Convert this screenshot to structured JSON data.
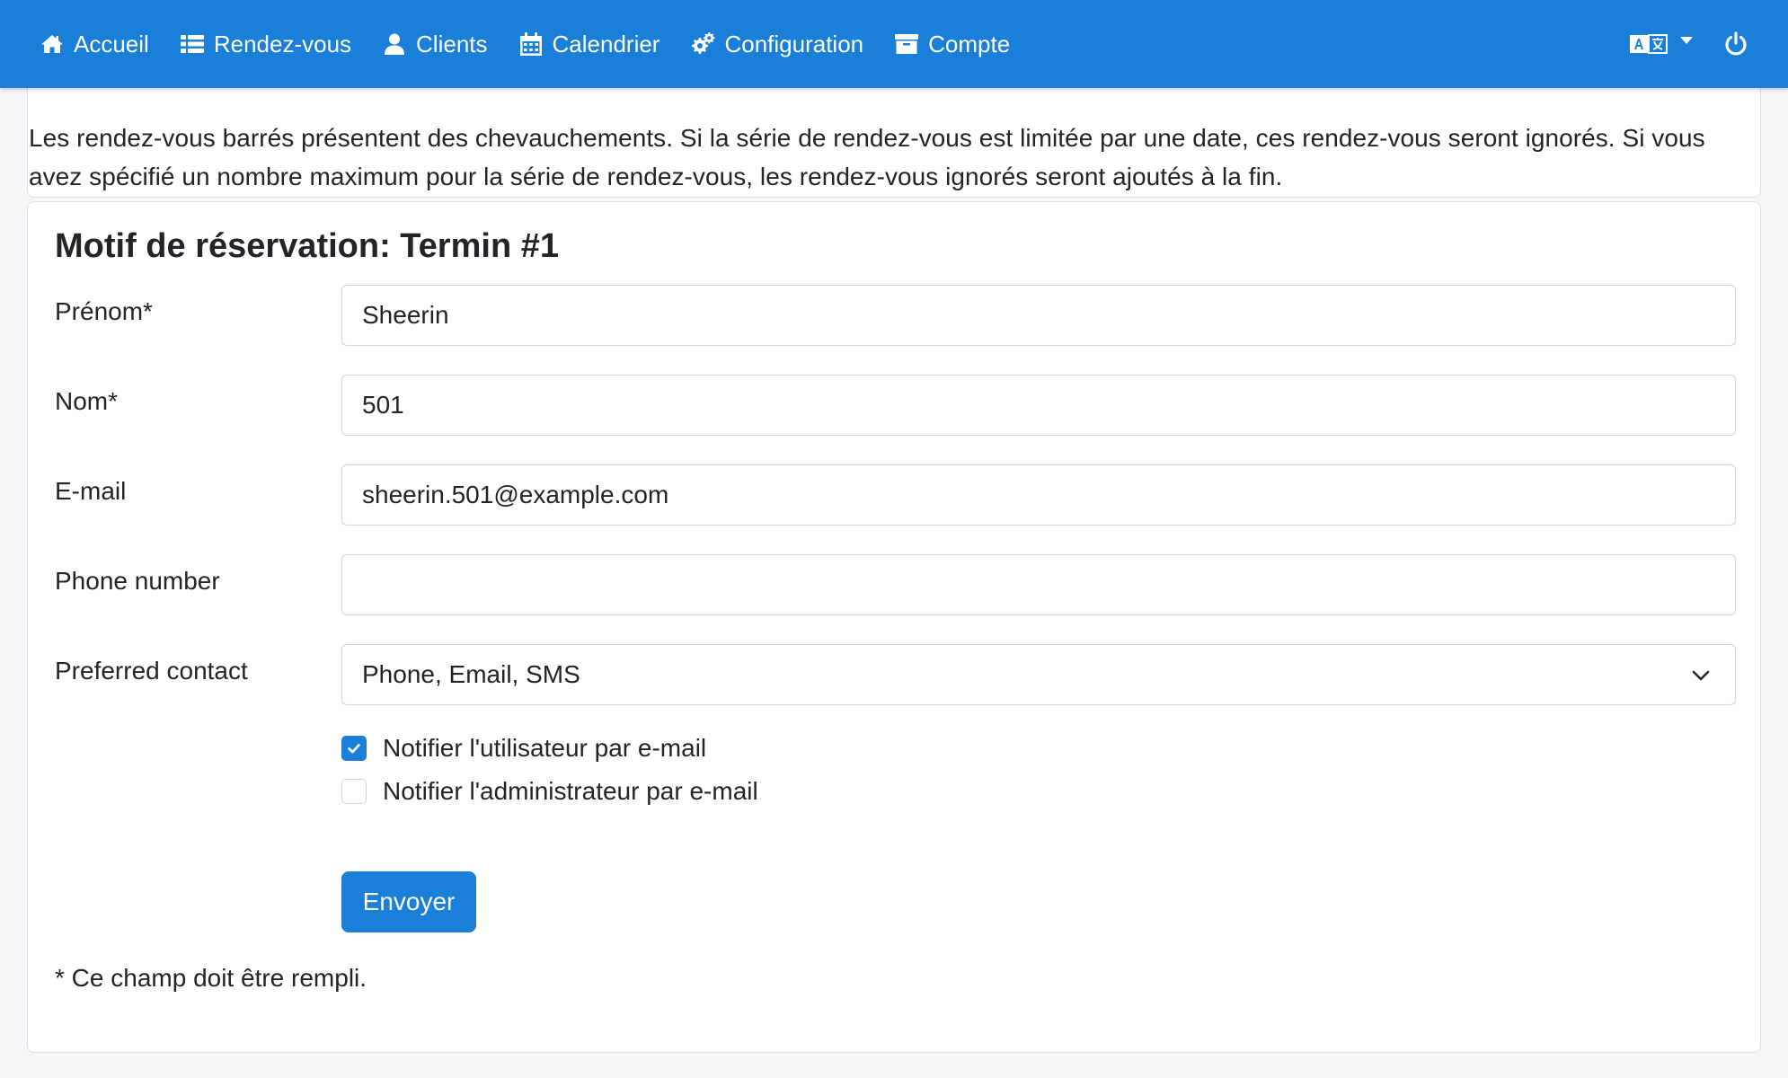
{
  "navbar": {
    "items": [
      {
        "label": "Accueil",
        "icon": "home-icon"
      },
      {
        "label": "Rendez-vous",
        "icon": "list-icon"
      },
      {
        "label": "Clients",
        "icon": "user-icon"
      },
      {
        "label": "Calendrier",
        "icon": "calendar-icon"
      },
      {
        "label": "Configuration",
        "icon": "cogs-icon"
      },
      {
        "label": "Compte",
        "icon": "archive-icon"
      }
    ],
    "language_icon": "language-icon",
    "logout_icon": "power-icon",
    "background_color": "#1a7fd9"
  },
  "notice": {
    "text": "Les rendez-vous barrés présentent des chevauchements. Si la série de rendez-vous est limitée par une date, ces rendez-vous seront ignorés. Si vous avez spécifié un nombre maximum pour la série de rendez-vous, les rendez-vous ignorés seront ajoutés à la fin."
  },
  "form": {
    "title": "Motif de réservation: Termin #1",
    "first_name": {
      "label": "Prénom*",
      "value": "Sheerin"
    },
    "last_name": {
      "label": "Nom*",
      "value": "501"
    },
    "email": {
      "label": "E-mail",
      "value": "sheerin.501@example.com"
    },
    "phone": {
      "label": "Phone number",
      "value": ""
    },
    "preferred_contact": {
      "label": "Preferred contact",
      "value": "Phone, Email, SMS"
    },
    "notify_user": {
      "label": "Notifier l'utilisateur par e-mail",
      "checked": true
    },
    "notify_admin": {
      "label": "Notifier l'administrateur par e-mail",
      "checked": false
    },
    "submit_label": "Envoyer",
    "footnote": "* Ce champ doit être rempli."
  },
  "colors": {
    "accent": "#1a7fd9",
    "page_background": "#f5f6f8"
  }
}
